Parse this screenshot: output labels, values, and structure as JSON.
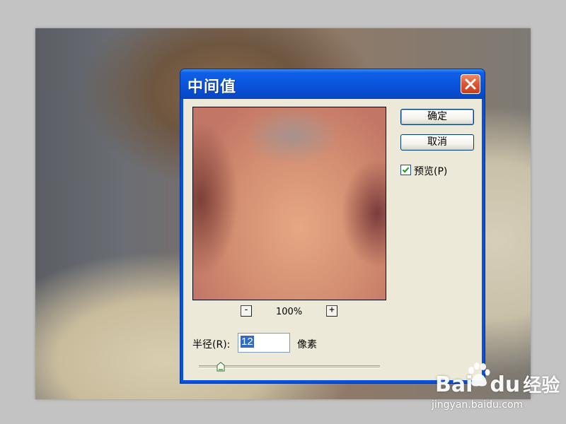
{
  "dialog": {
    "title": "中间值",
    "ok_label": "确定",
    "cancel_label": "取消",
    "preview_label": "预览(P)",
    "preview_checked": true,
    "zoom_minus": "-",
    "zoom_plus": "+",
    "zoom_value": "100%",
    "radius_label": "半径(R):",
    "radius_value": "12",
    "radius_unit": "像素",
    "radius_slider_fraction": 0.12
  },
  "watermark": {
    "logo_text": "Bai",
    "logo_text_2": "du",
    "logo_suffix": "经验",
    "url": "jingyan.baidu.com"
  },
  "icons": {
    "close": "close-icon",
    "check": "checkmark-icon",
    "slider": "slider-thumb-icon"
  }
}
